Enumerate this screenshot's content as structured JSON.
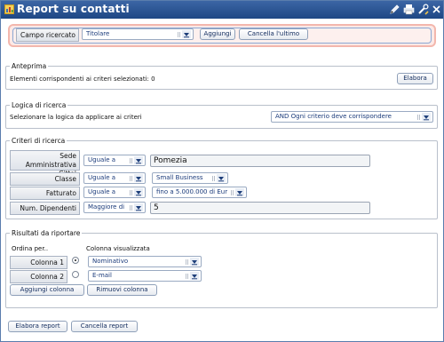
{
  "window": {
    "title": "Report su contatti"
  },
  "toolbar_icons": [
    "edit-icon",
    "print-icon",
    "tools-icon",
    "close-icon"
  ],
  "search": {
    "label": "Campo ricercato",
    "selected": "Titolare",
    "add_label": "Aggiungi",
    "remove_last_label": "Cancella l'ultimo"
  },
  "preview": {
    "legend": "Anteprima",
    "count_text": "Elementi corrispondenti ai criteri selezionati: 0",
    "process_label": "Elabora"
  },
  "logic": {
    "legend": "Logica di ricerca",
    "prompt": "Selezionare la logica da applicare ai criteri",
    "selected": "AND Ogni criterio deve corrispondere"
  },
  "criteria": {
    "legend": "Criteri di ricerca",
    "rows": [
      {
        "label": "Sede Amministrativa Citta'",
        "operator": "Uguale a",
        "value": "Pomezia"
      },
      {
        "label": "Classe",
        "operator": "Uguale a",
        "value": "Small Business"
      },
      {
        "label": "Fatturato",
        "operator": "Uguale a",
        "value": "fino a 5.000.000 di Eur"
      },
      {
        "label": "Num. Dipendenti",
        "operator": "Maggiore di",
        "value": "5"
      }
    ]
  },
  "results": {
    "legend": "Risultati da riportare",
    "order_by_header": "Ordina per..",
    "column_header": "Colonna visualizzata",
    "columns": [
      {
        "label": "Colonna 1",
        "order_checked": true,
        "value": "Nominativo"
      },
      {
        "label": "Colonna 2",
        "order_checked": false,
        "value": "E-mail"
      }
    ],
    "add_column_label": "Aggiungi colonna",
    "remove_column_label": "Rimuovi colonna"
  },
  "footer": {
    "run_report_label": "Elabora report",
    "cancel_report_label": "Cancella report"
  },
  "colors": {
    "titlebar": "#2a5595",
    "panel_border": "#f3b7ad",
    "panel_fill": "#fde9e6",
    "link_text": "#1a3a7a"
  }
}
